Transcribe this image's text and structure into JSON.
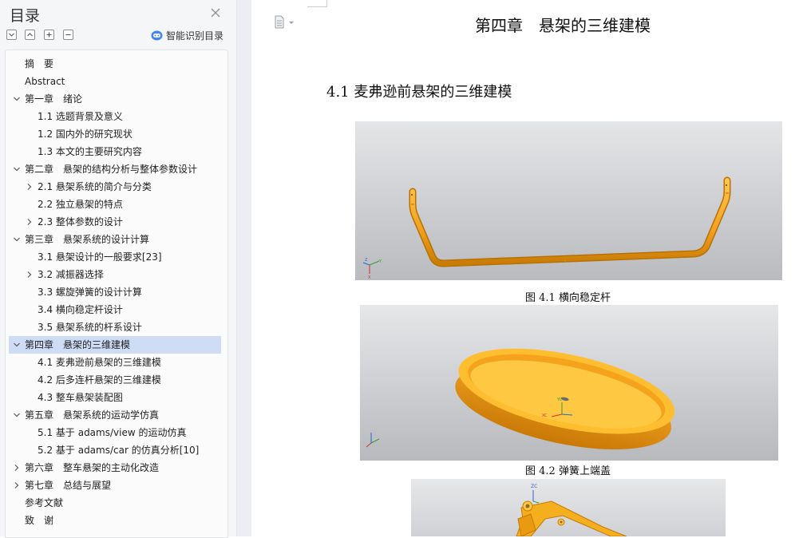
{
  "sidebar": {
    "title": "目录",
    "smart_toc_label": "智能识别目录",
    "items": [
      {
        "label": "摘　要",
        "level": 0,
        "caret": "none"
      },
      {
        "label": "Abstract",
        "level": 0,
        "caret": "none"
      },
      {
        "label": "第一章　绪论",
        "level": 0,
        "caret": "expanded"
      },
      {
        "label": "1.1 选题背景及意义",
        "level": 1,
        "caret": "none"
      },
      {
        "label": "1.2 国内外的研究现状",
        "level": 1,
        "caret": "none"
      },
      {
        "label": "1.3 本文的主要研究内容",
        "level": 1,
        "caret": "none"
      },
      {
        "label": "第二章　悬架的结构分析与整体参数设计",
        "level": 0,
        "caret": "expanded"
      },
      {
        "label": "2.1 悬架系统的简介与分类",
        "level": 1,
        "caret": "collapsed"
      },
      {
        "label": "2.2 独立悬架的特点",
        "level": 1,
        "caret": "none"
      },
      {
        "label": "2.3 整体参数的设计",
        "level": 1,
        "caret": "collapsed"
      },
      {
        "label": "第三章　悬架系统的设计计算",
        "level": 0,
        "caret": "expanded"
      },
      {
        "label": "3.1 悬架设计的一般要求[23]",
        "level": 1,
        "caret": "none"
      },
      {
        "label": "3.2 减振器选择",
        "level": 1,
        "caret": "collapsed"
      },
      {
        "label": "3.3 螺旋弹簧的设计计算",
        "level": 1,
        "caret": "none"
      },
      {
        "label": "3.4 横向稳定杆设计",
        "level": 1,
        "caret": "none"
      },
      {
        "label": "3.5 悬架系统的杆系设计",
        "level": 1,
        "caret": "none"
      },
      {
        "label": "第四章　悬架的三维建模",
        "level": 0,
        "caret": "expanded",
        "selected": true
      },
      {
        "label": "4.1 麦弗逊前悬架的三维建模",
        "level": 1,
        "caret": "none"
      },
      {
        "label": "4.2 后多连杆悬架的三维建模",
        "level": 1,
        "caret": "none"
      },
      {
        "label": "4.3 整车悬架装配图",
        "level": 1,
        "caret": "none"
      },
      {
        "label": "第五章　悬架系统的运动学仿真",
        "level": 0,
        "caret": "expanded"
      },
      {
        "label": "5.1 基于 adams/view 的运动仿真",
        "level": 1,
        "caret": "none"
      },
      {
        "label": "5.2 基于 adams/car 的仿真分析[10]",
        "level": 1,
        "caret": "none"
      },
      {
        "label": "第六章　整车悬架的主动化改造",
        "level": 0,
        "caret": "collapsed"
      },
      {
        "label": "第七章　总结与展望",
        "level": 0,
        "caret": "collapsed"
      },
      {
        "label": "参考文献",
        "level": 0,
        "caret": "none"
      },
      {
        "label": "致　谢",
        "level": 0,
        "caret": "none"
      }
    ]
  },
  "document": {
    "chapter_title": "第四章　悬架的三维建模",
    "section_title": "4.1 麦弗逊前悬架的三维建模",
    "figures": [
      {
        "caption": "图 4.1 横向稳定杆",
        "subject": "stabilizer-bar-model"
      },
      {
        "caption": "图 4.2 弹簧上端盖",
        "subject": "spring-upper-cap-model"
      },
      {
        "caption": "",
        "subject": "control-arm-model"
      }
    ],
    "triad_labels": {
      "zc": "ZC",
      "yc": "YC",
      "xc": "XC",
      "z": "Z",
      "y": "Y",
      "x": "X"
    }
  },
  "colors": {
    "selection": "#cfdcf6",
    "model_orange": "#f5a623",
    "model_orange_dark": "#d9860f",
    "viewport_grey": "#c9cbcf",
    "axis_x": "#d03030",
    "axis_y": "#2f9e3a",
    "axis_z": "#2f5fd0"
  }
}
